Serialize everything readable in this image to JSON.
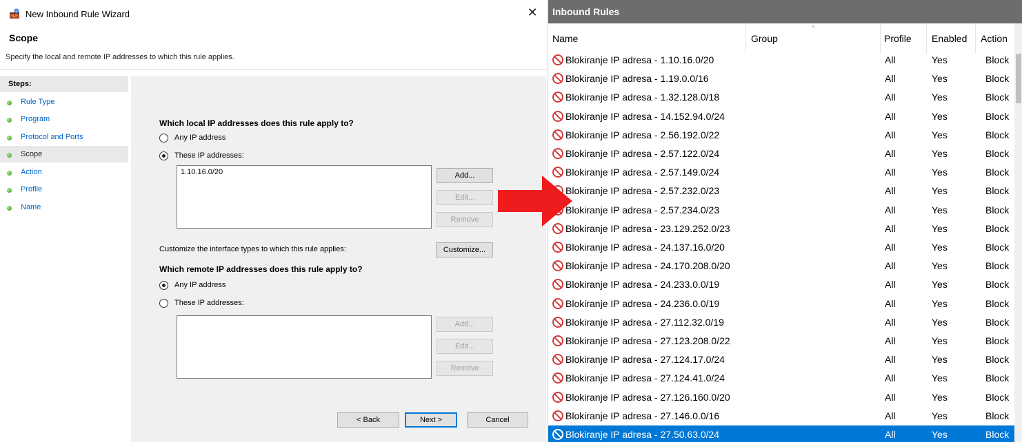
{
  "wizard": {
    "title": "New Inbound Rule Wizard",
    "close_glyph": "✕",
    "page_title": "Scope",
    "page_subtitle": "Specify the local and remote IP addresses to which this rule applies.",
    "steps_header": "Steps:",
    "steps": [
      {
        "label": "Rule Type",
        "current": false
      },
      {
        "label": "Program",
        "current": false
      },
      {
        "label": "Protocol and Ports",
        "current": false
      },
      {
        "label": "Scope",
        "current": true
      },
      {
        "label": "Action",
        "current": false
      },
      {
        "label": "Profile",
        "current": false
      },
      {
        "label": "Name",
        "current": false
      }
    ],
    "local": {
      "question": "Which local IP addresses does this rule apply to?",
      "any_label": "Any IP address",
      "these_label": "These IP addresses:",
      "selected": "these",
      "addresses": [
        "1.10.16.0/20"
      ],
      "add_label": "Add...",
      "edit_label": "Edit...",
      "remove_label": "Remove"
    },
    "customize_text": "Customize the interface types to which this rule applies:",
    "customize_label": "Customize...",
    "remote": {
      "question": "Which remote IP addresses does this rule apply to?",
      "any_label": "Any IP address",
      "these_label": "These IP addresses:",
      "selected": "any",
      "addresses": [],
      "add_label": "Add...",
      "edit_label": "Edit...",
      "remove_label": "Remove"
    },
    "back_label": "< Back",
    "next_label": "Next >",
    "cancel_label": "Cancel"
  },
  "rules_panel": {
    "title": "Inbound Rules",
    "columns": {
      "name": "Name",
      "group": "Group",
      "profile": "Profile",
      "enabled": "Enabled",
      "action": "Action"
    },
    "rows": [
      {
        "name": "Blokiranje IP adresa - 1.10.16.0/20",
        "profile": "All",
        "enabled": "Yes",
        "action": "Block",
        "selected": false
      },
      {
        "name": "Blokiranje IP adresa - 1.19.0.0/16",
        "profile": "All",
        "enabled": "Yes",
        "action": "Block",
        "selected": false
      },
      {
        "name": "Blokiranje IP adresa - 1.32.128.0/18",
        "profile": "All",
        "enabled": "Yes",
        "action": "Block",
        "selected": false
      },
      {
        "name": "Blokiranje IP adresa - 14.152.94.0/24",
        "profile": "All",
        "enabled": "Yes",
        "action": "Block",
        "selected": false
      },
      {
        "name": "Blokiranje IP adresa - 2.56.192.0/22",
        "profile": "All",
        "enabled": "Yes",
        "action": "Block",
        "selected": false
      },
      {
        "name": "Blokiranje IP adresa - 2.57.122.0/24",
        "profile": "All",
        "enabled": "Yes",
        "action": "Block",
        "selected": false
      },
      {
        "name": "Blokiranje IP adresa - 2.57.149.0/24",
        "profile": "All",
        "enabled": "Yes",
        "action": "Block",
        "selected": false
      },
      {
        "name": "Blokiranje IP adresa - 2.57.232.0/23",
        "profile": "All",
        "enabled": "Yes",
        "action": "Block",
        "selected": false
      },
      {
        "name": "Blokiranje IP adresa - 2.57.234.0/23",
        "profile": "All",
        "enabled": "Yes",
        "action": "Block",
        "selected": false
      },
      {
        "name": "Blokiranje IP adresa - 23.129.252.0/23",
        "profile": "All",
        "enabled": "Yes",
        "action": "Block",
        "selected": false
      },
      {
        "name": "Blokiranje IP adresa - 24.137.16.0/20",
        "profile": "All",
        "enabled": "Yes",
        "action": "Block",
        "selected": false
      },
      {
        "name": "Blokiranje IP adresa - 24.170.208.0/20",
        "profile": "All",
        "enabled": "Yes",
        "action": "Block",
        "selected": false
      },
      {
        "name": "Blokiranje IP adresa - 24.233.0.0/19",
        "profile": "All",
        "enabled": "Yes",
        "action": "Block",
        "selected": false
      },
      {
        "name": "Blokiranje IP adresa - 24.236.0.0/19",
        "profile": "All",
        "enabled": "Yes",
        "action": "Block",
        "selected": false
      },
      {
        "name": "Blokiranje IP adresa - 27.112.32.0/19",
        "profile": "All",
        "enabled": "Yes",
        "action": "Block",
        "selected": false
      },
      {
        "name": "Blokiranje IP adresa - 27.123.208.0/22",
        "profile": "All",
        "enabled": "Yes",
        "action": "Block",
        "selected": false
      },
      {
        "name": "Blokiranje IP adresa - 27.124.17.0/24",
        "profile": "All",
        "enabled": "Yes",
        "action": "Block",
        "selected": false
      },
      {
        "name": "Blokiranje IP adresa - 27.124.41.0/24",
        "profile": "All",
        "enabled": "Yes",
        "action": "Block",
        "selected": false
      },
      {
        "name": "Blokiranje IP adresa - 27.126.160.0/20",
        "profile": "All",
        "enabled": "Yes",
        "action": "Block",
        "selected": false
      },
      {
        "name": "Blokiranje IP adresa - 27.146.0.0/16",
        "profile": "All",
        "enabled": "Yes",
        "action": "Block",
        "selected": false
      },
      {
        "name": "Blokiranje IP adresa - 27.50.63.0/24",
        "profile": "All",
        "enabled": "Yes",
        "action": "Block",
        "selected": true
      }
    ]
  },
  "icons": {
    "wizard_icon": "firewall-wizard-icon",
    "row_icon": "block-rule-icon",
    "arrow": "red-right-arrow"
  },
  "colors": {
    "accent": "#0078d7",
    "panel_title_bg": "#6d6d6d",
    "step_link": "#0066cc",
    "block_icon": "#d43b3b",
    "arrow": "#ee1c1c"
  }
}
